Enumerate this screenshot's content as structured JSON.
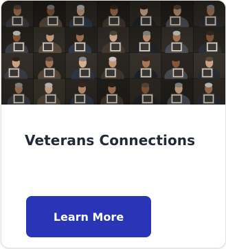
{
  "card": {
    "image": {
      "icon": "veterans-portrait-collage"
    },
    "title": "Veterans Connections",
    "cta_label": "Learn More"
  },
  "colors": {
    "button_bg": "#2a34b7",
    "title_text": "#222a35"
  }
}
